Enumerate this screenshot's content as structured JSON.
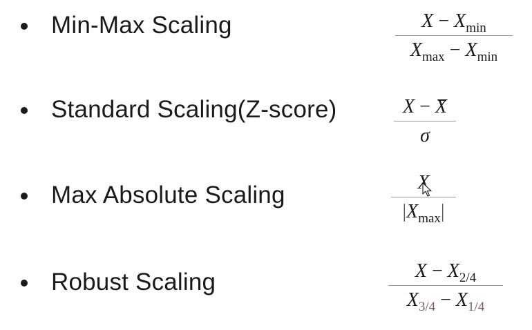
{
  "items": [
    {
      "label": "Min-Max Scaling",
      "formula": {
        "num_x": "X",
        "num_minus": "−",
        "num_x2": "X",
        "num_sub": "min",
        "den_x": "X",
        "den_sub1": "max",
        "den_minus": "−",
        "den_x2": "X",
        "den_sub2": "min"
      }
    },
    {
      "label": "Standard Scaling(Z-score)",
      "formula": {
        "num_x": "X",
        "num_minus": "−",
        "num_xbar": "X",
        "den": "σ"
      }
    },
    {
      "label": "Max Absolute Scaling",
      "formula": {
        "num": "X",
        "den_bar_l": "|",
        "den_x": "X",
        "den_sub": "max",
        "den_bar_r": "|"
      }
    },
    {
      "label": "Robust Scaling",
      "formula": {
        "num_x": "X",
        "num_minus": "−",
        "num_x2": "X",
        "num_sub": "2/4",
        "den_x": "X",
        "den_sub1": "3/4",
        "den_minus": "−",
        "den_x2": "X",
        "den_sub2": "1/4"
      }
    }
  ],
  "colors": {
    "text": "#1a1a1a",
    "fraction_bar": "#9a9a9a",
    "subscript_dim": "#7a5a5a"
  },
  "icons": {
    "cursor": "mouse-pointer-icon"
  }
}
